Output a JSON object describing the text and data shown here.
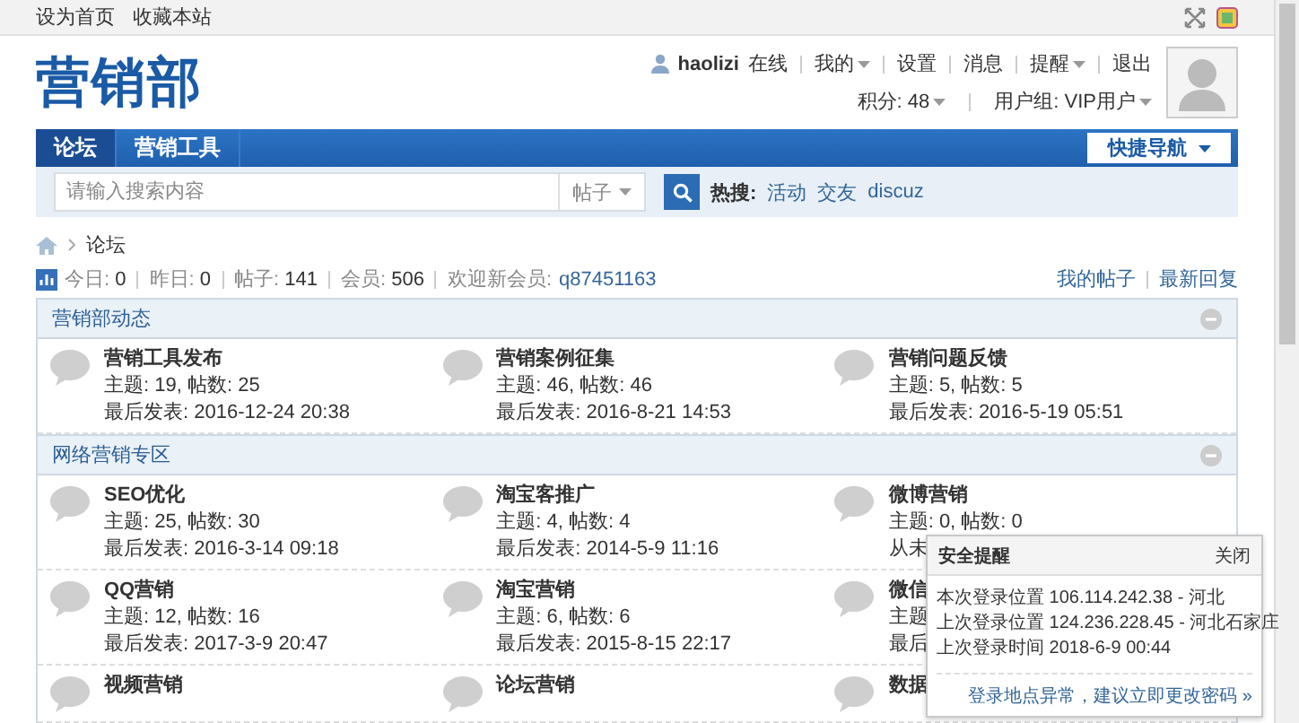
{
  "topbar": {
    "links": [
      "设为首页",
      "收藏本站"
    ]
  },
  "header": {
    "logo": "营销部",
    "user": {
      "name": "haolizi",
      "status": "在线"
    },
    "menu": [
      {
        "label": "我的",
        "dropdown": true
      },
      {
        "label": "设置",
        "dropdown": false
      },
      {
        "label": "消息",
        "dropdown": false
      },
      {
        "label": "提醒",
        "dropdown": true
      },
      {
        "label": "退出",
        "dropdown": false
      }
    ],
    "info": [
      {
        "label": "积分: 48",
        "dropdown": true
      },
      {
        "label": "用户组: VIP用户",
        "dropdown": true
      }
    ]
  },
  "nav": {
    "tabs": [
      {
        "label": "论坛",
        "selected": true
      },
      {
        "label": "营销工具",
        "selected": false
      }
    ],
    "quick": "快捷导航"
  },
  "search": {
    "placeholder": "请输入搜索内容",
    "type": "帖子",
    "hot_label": "热搜:",
    "hot": [
      "活动",
      "交友",
      "discuz"
    ]
  },
  "breadcrumb": [
    "论坛"
  ],
  "stats": {
    "items": [
      {
        "label": "今日:",
        "value": "0"
      },
      {
        "label": "昨日:",
        "value": "0"
      },
      {
        "label": "帖子:",
        "value": "141"
      },
      {
        "label": "会员:",
        "value": "506"
      }
    ],
    "welcome": "欢迎新会员:",
    "new_member": "q87451163",
    "links": [
      "我的帖子",
      "最新回复"
    ]
  },
  "sections": [
    {
      "title": "营销部动态",
      "expanded": true,
      "rows": [
        [
          {
            "name": "营销工具发布",
            "stats": "主题: 19, 帖数: 25",
            "last": "最后发表: 2016-12-24 20:38"
          },
          {
            "name": "营销案例征集",
            "stats": "主题: 46, 帖数: 46",
            "last": "最后发表: 2016-8-21 14:53"
          },
          {
            "name": "营销问题反馈",
            "stats": "主题: 5, 帖数: 5",
            "last": "最后发表: 2016-5-19 05:51"
          }
        ]
      ]
    },
    {
      "title": "网络营销专区",
      "expanded": true,
      "rows": [
        [
          {
            "name": "SEO优化",
            "stats": "主题: 25, 帖数: 30",
            "last": "最后发表: 2016-3-14 09:18"
          },
          {
            "name": "淘宝客推广",
            "stats": "主题: 4, 帖数: 4",
            "last": "最后发表: 2014-5-9 11:16"
          },
          {
            "name": "微博营销",
            "stats": "主题: 0, 帖数: 0",
            "last": "从未"
          }
        ],
        [
          {
            "name": "QQ营销",
            "stats": "主题: 12, 帖数: 16",
            "last": "最后发表: 2017-3-9 20:47"
          },
          {
            "name": "淘宝营销",
            "stats": "主题: 6, 帖数: 6",
            "last": "最后发表: 2015-8-15 22:17"
          },
          {
            "name": "微信",
            "stats": "主题",
            "last": "最后"
          }
        ],
        [
          {
            "name": "视频营销"
          },
          {
            "name": "论坛营销"
          },
          {
            "name": "数据"
          }
        ]
      ]
    }
  ],
  "popup": {
    "title": "安全提醒",
    "close": "关闭",
    "lines": [
      "本次登录位置 106.114.242.38 - 河北",
      "上次登录位置 124.236.228.45 - 河北石家庄",
      "上次登录时间 2018-6-9 00:44"
    ],
    "link": "登录地点异常，建议立即更改密码 »"
  }
}
